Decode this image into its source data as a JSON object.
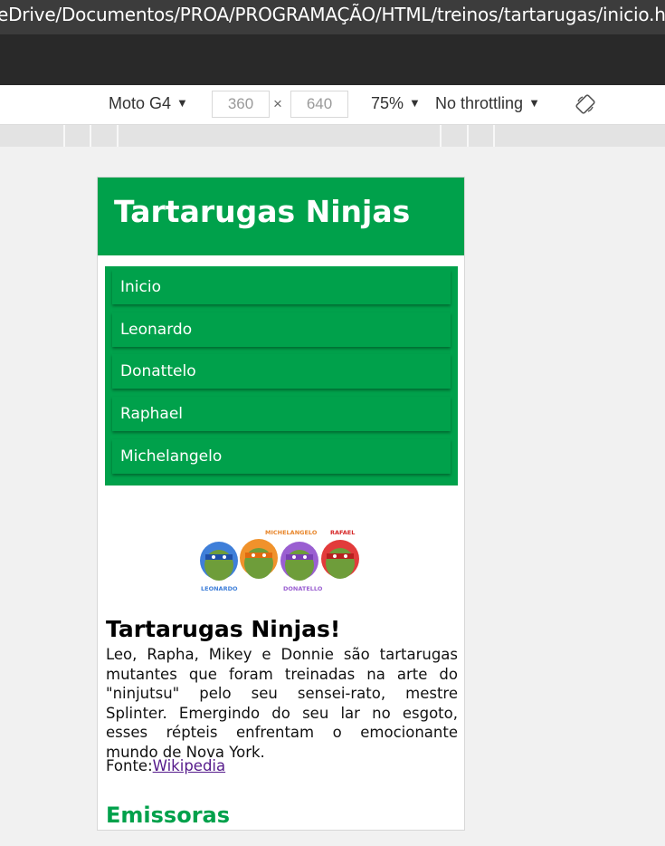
{
  "browser": {
    "address": "eDrive/Documentos/PROA/PROGRAMAÇÃO/HTML/treinos/tartarugas/inicio.htm"
  },
  "device_toolbar": {
    "device": "Moto G4",
    "width": "360",
    "height": "640",
    "times": "×",
    "zoom": "75%",
    "throttling": "No throttling",
    "rotate_icon": "rotate-device-icon"
  },
  "page": {
    "header_title": "Tartarugas Ninjas",
    "nav_items": [
      "Inicio",
      "Leonardo",
      "Donattelo",
      "Raphael",
      "Michelangelo"
    ],
    "image_labels": {
      "michelangelo": "MICHELANGELO",
      "rafael": "RAFAEL",
      "leonardo": "LEONARDO",
      "donatello": "DONATELLO"
    },
    "content_title": "Tartarugas Ninjas!",
    "content_body": "Leo, Rapha, Mikey e Donnie são tartarugas mutantes que foram treinadas na arte do \"ninjutsu\" pelo seu sensei-rato, mestre Splinter. Emergindo do seu lar no esgoto, esses répteis enfrentam o emocionante mundo de Nova York.",
    "source_prefix": "Fonte:",
    "source_link": "Wikipedia",
    "section_title": "Emissoras",
    "colors": {
      "brand_green": "#00a14b",
      "link_visited": "#551a8b"
    }
  }
}
